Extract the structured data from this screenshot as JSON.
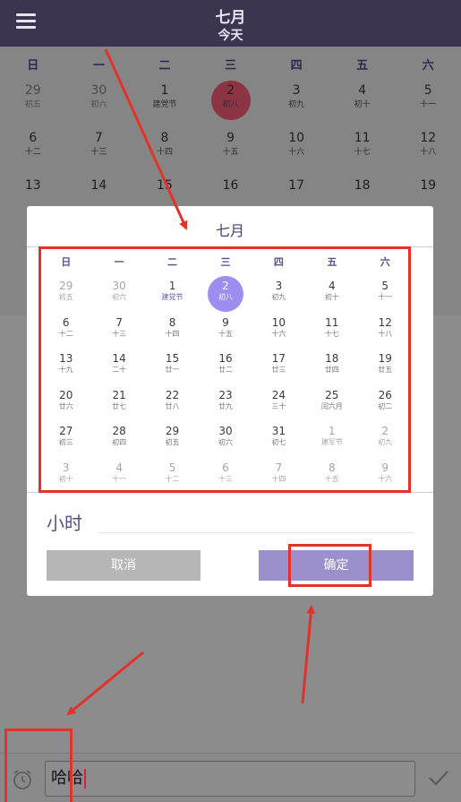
{
  "header": {
    "title": "七月",
    "subtitle": "今天"
  },
  "background_calendar": {
    "weekdays": [
      "日",
      "一",
      "二",
      "三",
      "四",
      "五",
      "六"
    ],
    "rows": [
      [
        {
          "d": "29",
          "l": "初五",
          "other": true
        },
        {
          "d": "30",
          "l": "初六",
          "other": true
        },
        {
          "d": "1",
          "l": "建党节"
        },
        {
          "d": "2",
          "l": "初八",
          "today": true
        },
        {
          "d": "3",
          "l": "初九"
        },
        {
          "d": "4",
          "l": "初十"
        },
        {
          "d": "5",
          "l": "十一"
        }
      ],
      [
        {
          "d": "6",
          "l": "十二"
        },
        {
          "d": "7",
          "l": "十三"
        },
        {
          "d": "8",
          "l": "十四"
        },
        {
          "d": "9",
          "l": "十五"
        },
        {
          "d": "10",
          "l": "十六"
        },
        {
          "d": "11",
          "l": "十七"
        },
        {
          "d": "12",
          "l": "十八"
        }
      ],
      [
        {
          "d": "13",
          "l": ""
        },
        {
          "d": "14",
          "l": ""
        },
        {
          "d": "15",
          "l": ""
        },
        {
          "d": "16",
          "l": ""
        },
        {
          "d": "17",
          "l": ""
        },
        {
          "d": "18",
          "l": ""
        },
        {
          "d": "19",
          "l": ""
        }
      ]
    ]
  },
  "dialog": {
    "title": "七月",
    "weekdays": [
      "日",
      "一",
      "二",
      "三",
      "四",
      "五",
      "六"
    ],
    "rows": [
      [
        {
          "d": "29",
          "l": "初五",
          "other": true
        },
        {
          "d": "30",
          "l": "初六",
          "other": true
        },
        {
          "d": "1",
          "l": "建党节",
          "fest": true
        },
        {
          "d": "2",
          "l": "初八",
          "sel": true
        },
        {
          "d": "3",
          "l": "初九"
        },
        {
          "d": "4",
          "l": "初十"
        },
        {
          "d": "5",
          "l": "十一"
        }
      ],
      [
        {
          "d": "6",
          "l": "十二"
        },
        {
          "d": "7",
          "l": "十三"
        },
        {
          "d": "8",
          "l": "十四"
        },
        {
          "d": "9",
          "l": "十五"
        },
        {
          "d": "10",
          "l": "十六"
        },
        {
          "d": "11",
          "l": "十七"
        },
        {
          "d": "12",
          "l": "十八"
        }
      ],
      [
        {
          "d": "13",
          "l": "十九"
        },
        {
          "d": "14",
          "l": "二十"
        },
        {
          "d": "15",
          "l": "廿一"
        },
        {
          "d": "16",
          "l": "廿二"
        },
        {
          "d": "17",
          "l": "廿三"
        },
        {
          "d": "18",
          "l": "廿四"
        },
        {
          "d": "19",
          "l": "廿五"
        }
      ],
      [
        {
          "d": "20",
          "l": "廿六"
        },
        {
          "d": "21",
          "l": "廿七"
        },
        {
          "d": "22",
          "l": "廿八"
        },
        {
          "d": "23",
          "l": "廿九"
        },
        {
          "d": "24",
          "l": "三十"
        },
        {
          "d": "25",
          "l": "闰六月"
        },
        {
          "d": "26",
          "l": "初二"
        }
      ],
      [
        {
          "d": "27",
          "l": "初三"
        },
        {
          "d": "28",
          "l": "初四"
        },
        {
          "d": "29",
          "l": "初五"
        },
        {
          "d": "30",
          "l": "初六"
        },
        {
          "d": "31",
          "l": "初七"
        },
        {
          "d": "1",
          "l": "建军节",
          "other": true
        },
        {
          "d": "2",
          "l": "初九",
          "other": true
        }
      ],
      [
        {
          "d": "3",
          "l": "初十",
          "other": true
        },
        {
          "d": "4",
          "l": "十一",
          "other": true
        },
        {
          "d": "5",
          "l": "十二",
          "other": true
        },
        {
          "d": "6",
          "l": "十三",
          "other": true
        },
        {
          "d": "7",
          "l": "十四",
          "other": true
        },
        {
          "d": "8",
          "l": "十五",
          "other": true
        },
        {
          "d": "9",
          "l": "十六",
          "other": true
        }
      ]
    ],
    "hours_label": "小时",
    "cancel_label": "取消",
    "ok_label": "确定"
  },
  "input_bar": {
    "value": "哈哈"
  },
  "colors": {
    "header_bg": "#3d3452",
    "selected_day": "#9a8ef0",
    "ok_button": "#9d8fcb",
    "cancel_button": "#b6b6b6",
    "annotation_red": "#e2332b"
  },
  "icons": {
    "menu": "hamburger-menu-icon",
    "alarm": "alarm-clock-icon",
    "send": "checkmark-icon"
  }
}
